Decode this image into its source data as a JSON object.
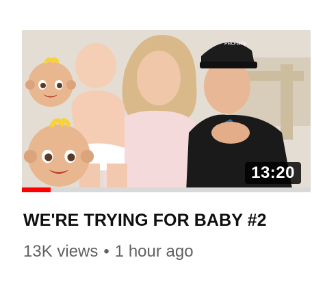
{
  "video": {
    "duration": "13:20",
    "watched_fraction": 0.1,
    "title": "WE'RE TRYING FOR BABY #2",
    "views": "13K views",
    "separator": "•",
    "age": "1 hour ago"
  },
  "thumbnail": {
    "emoji": "baby-face-emoji",
    "cap_text": "PRO-LITE"
  },
  "colors": {
    "progress": "#ff0000",
    "title": "#0f0f0f",
    "meta": "#606060",
    "duration_bg": "#000000"
  }
}
